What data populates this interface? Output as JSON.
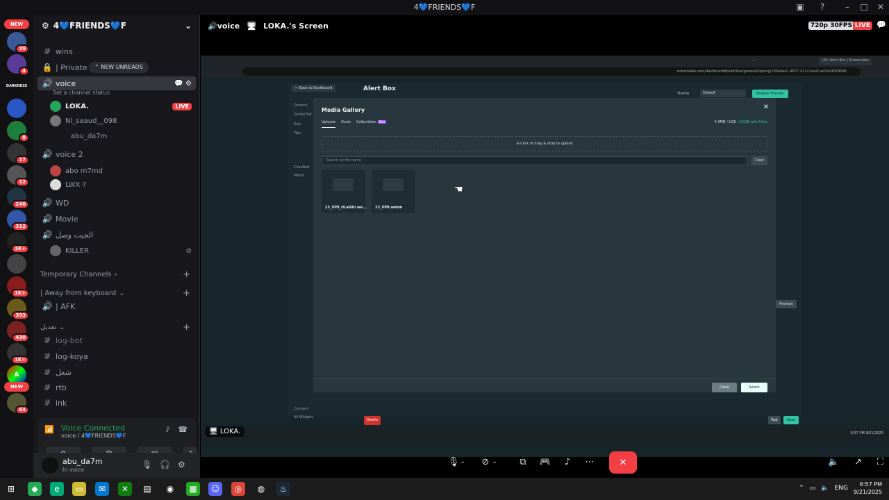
{
  "window": {
    "title": "4💙FRIENDS💙F"
  },
  "rail": {
    "new_label": "NEW",
    "badges": [
      "39",
      "4",
      "17",
      "8",
      "12",
      "246",
      "312",
      "1K+",
      "1K+",
      "393",
      "430",
      "1K+",
      "64"
    ],
    "server_initials": {
      "dabbs": "DARKNESS",
      "a": "A"
    }
  },
  "server": {
    "name": "4💙FRIENDS💙F"
  },
  "new_unreads": "NEW UNREADS",
  "channels": {
    "wins": "wins",
    "private": "| Private",
    "voice": "voice",
    "voice_status": "Set a channel status",
    "voice_users": [
      {
        "name": "LOKA.",
        "live": "LIVE"
      },
      {
        "name": "Nl_saaud__098"
      },
      {
        "name": "abu_da7m"
      }
    ],
    "voice2": "voice 2",
    "voice2_users": [
      {
        "name": "abo m7md"
      },
      {
        "name": "LWX ?"
      }
    ],
    "wd": "WD",
    "movie": "Movie",
    "arabic_channel": "الجيت وصل",
    "killer": "KILLER",
    "temp_category": "Temporary Channels",
    "afk_category": "| Away from keyboard",
    "afk": "| AFK",
    "misc_category": "تعديل",
    "log_bot": "log-bot",
    "log_koya": "log-koya",
    "arabic2": "شغل",
    "rtb": "rtb",
    "ink": "ink"
  },
  "voice_panel": {
    "status": "Voice Connected",
    "sub": "voice / 4💙FRIENDS💙F"
  },
  "user": {
    "name": "abu_da7m",
    "status": "In voice"
  },
  "stage": {
    "channel": "voice",
    "screen_name": "LOKA.'s Screen",
    "quality": "720p 30FPS",
    "live": "LIVE",
    "sharer": "LOKA."
  },
  "shared_screen": {
    "url": "streamlabs.com/dashboard#/alertbox/general/tipping/190a4ed1-4627-4122-bad2-ad1d249180d6",
    "tab_active": "(20) Alert Box | Streamlabs",
    "back": "← Back to Dashboard",
    "page_title": "Alert Box",
    "theme_label": "Theme",
    "theme_value": "Default",
    "browse_themes": "Browse Themes",
    "nav": [
      "General",
      "Global Set",
      "Kick",
      "Tips",
      "Merch",
      "Cloudbot",
      "Connect",
      "All Widgets"
    ],
    "modal": {
      "title": "Media Gallery",
      "tabs": [
        "Uploads",
        "Stock",
        "Collectibles"
      ],
      "new_badge": "New",
      "storage": "4.9MB / 1GB",
      "storage_upsell": "+10GB with Ultra",
      "drop": "Click or drag & drop to upload",
      "search_placeholder": "Search by file name",
      "clear": "Clear",
      "files": [
        "23_VP9_rlLa6lhl.we...",
        "23_VP9.webm"
      ],
      "close_btn": "Close",
      "select_btn": "Select"
    },
    "delete": "Delete",
    "preview": "Preview",
    "test": "Test",
    "save": "Save",
    "clock": "8:57 PM\n9/21/2025"
  },
  "taskbar": {
    "lang": "ENG",
    "time": "6:57 PM",
    "date": "9/21/2025"
  }
}
